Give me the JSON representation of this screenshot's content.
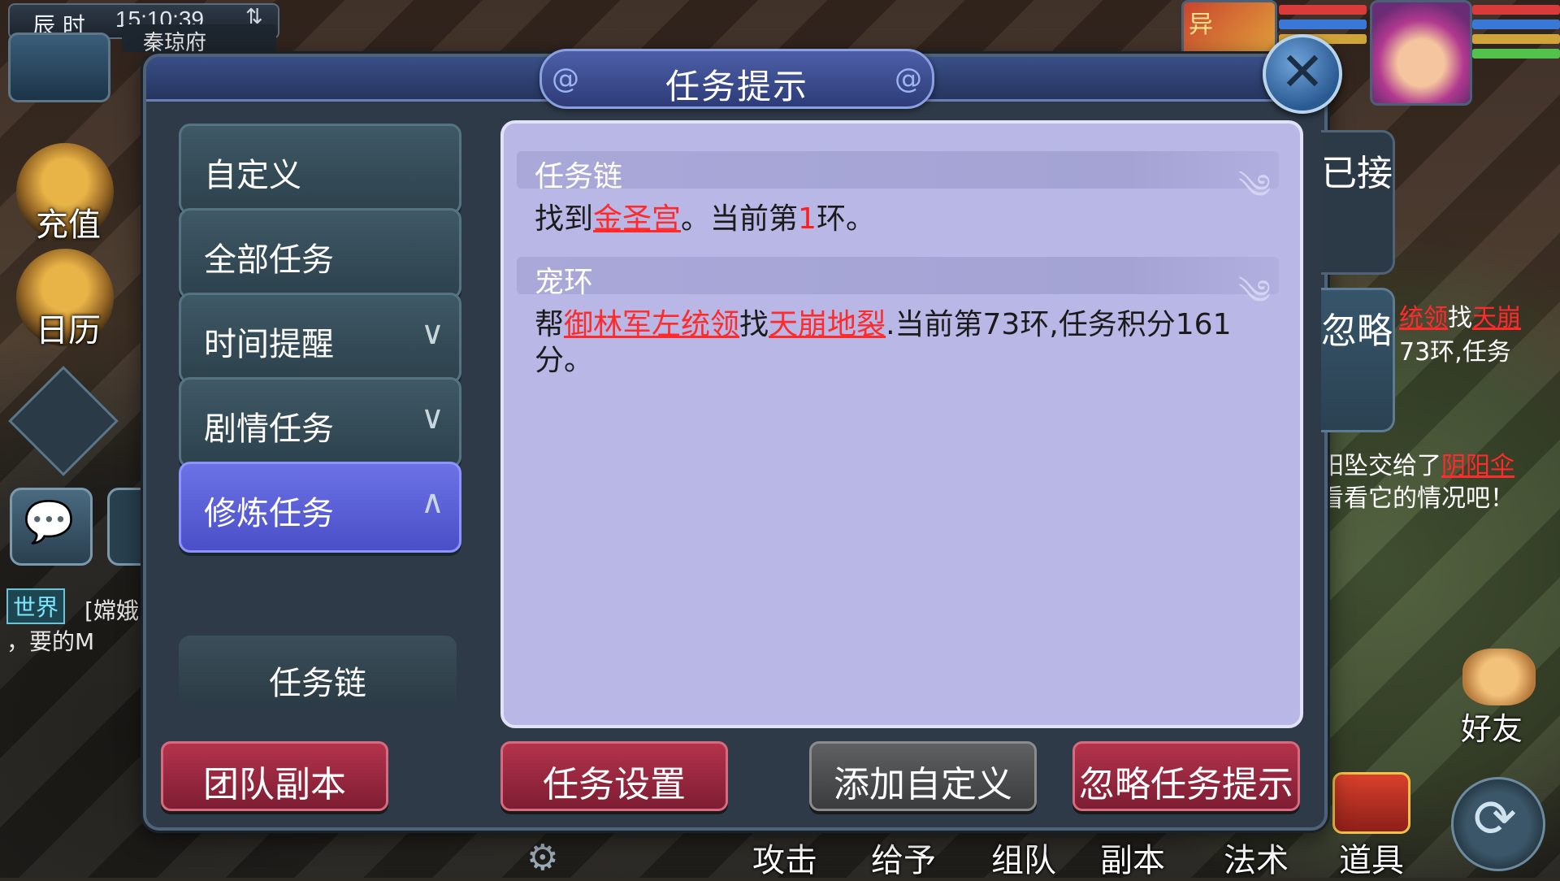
{
  "hud": {
    "time_label": "辰 时",
    "clock": "15:10:39",
    "map_name": "秦琼府",
    "recharge_label": "充值",
    "calendar_label": "日历",
    "chat_channel": "世界",
    "chat_line1": "[嫦娥",
    "chat_line2": "，要的M",
    "enemy_badge": "异"
  },
  "dialog": {
    "title": "任务提示",
    "close_symbol": "✕"
  },
  "menu": {
    "items": [
      {
        "label": "自定义"
      },
      {
        "label": "全部任务"
      },
      {
        "label": "时间提醒"
      },
      {
        "label": "剧情任务"
      },
      {
        "label": "修炼任务"
      }
    ],
    "sub_item": "任务链"
  },
  "content": {
    "sections": [
      {
        "title": "任务链",
        "parts": [
          "找到",
          "金圣宫",
          "。当前第",
          "1",
          "环。"
        ]
      },
      {
        "title": "宠环",
        "parts": [
          "帮",
          "御林军左统领",
          "找",
          "天崩地裂",
          ".当前第73环,任务积分161分。"
        ]
      }
    ]
  },
  "tabs": {
    "accepted": "已接",
    "ignore": "忽略"
  },
  "buttons": {
    "team_dungeon": "团队副本",
    "task_settings": "任务设置",
    "add_custom": "添加自定义",
    "ignore_tips": "忽略任务提示"
  },
  "right_panel": {
    "line1_a": "统领",
    "line1_b": "找",
    "line1_c": "天崩",
    "line2": "73环,任务",
    "line3_a": "阳坠交给了",
    "line3_b": "阴阳伞",
    "line4": "看看它的情况吧！"
  },
  "bottom_bar": {
    "attack": "攻击",
    "give": "给予",
    "team": "组队",
    "dungeon": "副本",
    "spell": "法术",
    "item": "道具",
    "friend": "好友"
  },
  "colors": {
    "highlight_red": "#ff1d1d",
    "content_bg": "#b8b7e6",
    "active_tab": "#5a60d8",
    "red_button": "#9a2640"
  }
}
